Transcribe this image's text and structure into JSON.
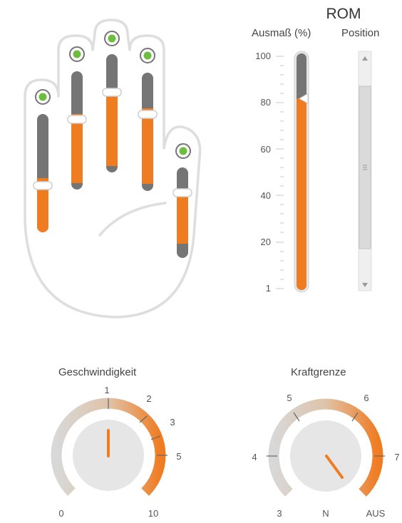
{
  "rom": {
    "title": "ROM",
    "range_label": "Ausmaß (%)",
    "position_label": "Position",
    "ticks": [
      "100",
      "80",
      "60",
      "40",
      "20",
      "1"
    ],
    "value_percent": 82
  },
  "hand": {
    "fingers": [
      {
        "name": "thumb",
        "marker_percent": 35,
        "indicator": "active"
      },
      {
        "name": "index",
        "marker_percent": 73,
        "indicator": "active"
      },
      {
        "name": "middle",
        "marker_percent": 87,
        "indicator": "active"
      },
      {
        "name": "ring",
        "marker_percent": 87,
        "indicator": "active"
      },
      {
        "name": "little",
        "marker_percent": 37,
        "indicator": "active"
      }
    ]
  },
  "gauges": {
    "speed": {
      "title": "Geschwindigkeit",
      "labels": {
        "l0": "0",
        "l1": "1",
        "l2": "2",
        "l3": "3",
        "l5": "5",
        "l10": "10"
      }
    },
    "force": {
      "title": "Kraftgrenze",
      "labels": {
        "l3": "3",
        "l4": "4",
        "l5": "5",
        "l6": "6",
        "l7": "7",
        "lN": "N",
        "lAUS": "AUS"
      }
    }
  },
  "colors": {
    "accent": "#f07c22",
    "track": "#757575",
    "indicator": "#6bbf3d",
    "outline": "#d9d9d9"
  }
}
